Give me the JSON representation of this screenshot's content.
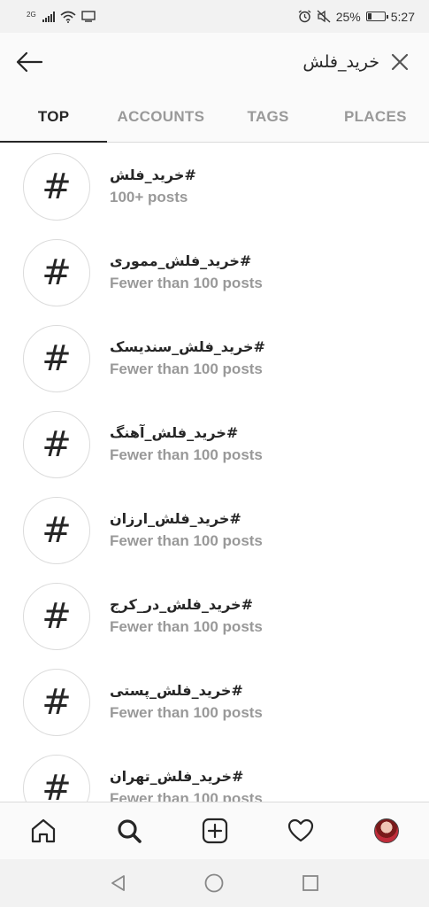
{
  "status_bar": {
    "network": "2G",
    "battery_text": "25%",
    "battery_level": 0.25,
    "time": "5:27",
    "icons": [
      "signal-icon",
      "wifi-icon",
      "screen-cast-icon",
      "alarm-icon",
      "mute-icon",
      "battery-icon"
    ]
  },
  "header": {
    "back_icon": "arrow-left-icon",
    "search_value": "خرید_فلش",
    "clear_icon": "close-icon"
  },
  "tabs": [
    {
      "label": "TOP",
      "active": true
    },
    {
      "label": "ACCOUNTS",
      "active": false
    },
    {
      "label": "TAGS",
      "active": false
    },
    {
      "label": "PLACES",
      "active": false
    }
  ],
  "results": [
    {
      "name": "#خرید_فلش",
      "count": "100+ posts",
      "icon": "hashtag-icon"
    },
    {
      "name": "#خرید_فلش_مموری",
      "count": "Fewer than 100 posts",
      "icon": "hashtag-icon"
    },
    {
      "name": "#خرید_فلش_سندیسک",
      "count": "Fewer than 100 posts",
      "icon": "hashtag-icon"
    },
    {
      "name": "#خرید_فلش_آهنگ",
      "count": "Fewer than 100 posts",
      "icon": "hashtag-icon"
    },
    {
      "name": "#خرید_فلش_ارزان",
      "count": "Fewer than 100 posts",
      "icon": "hashtag-icon"
    },
    {
      "name": "#خرید_فلش_در_کرج",
      "count": "Fewer than 100 posts",
      "icon": "hashtag-icon"
    },
    {
      "name": "#خرید_فلش_پستی",
      "count": "Fewer than 100 posts",
      "icon": "hashtag-icon"
    },
    {
      "name": "#خرید_فلش_تهران",
      "count": "Fewer than 100 posts",
      "icon": "hashtag-icon"
    }
  ],
  "bottom_nav": [
    "home-icon",
    "search-icon",
    "add-post-icon",
    "heart-icon",
    "profile-avatar"
  ],
  "system_nav": [
    "back-triangle-icon",
    "home-circle-icon",
    "recents-square-icon"
  ],
  "colors": {
    "text": "#262626",
    "muted": "#999999",
    "border": "#dbdbdb",
    "bar_bg": "#fafafa"
  }
}
